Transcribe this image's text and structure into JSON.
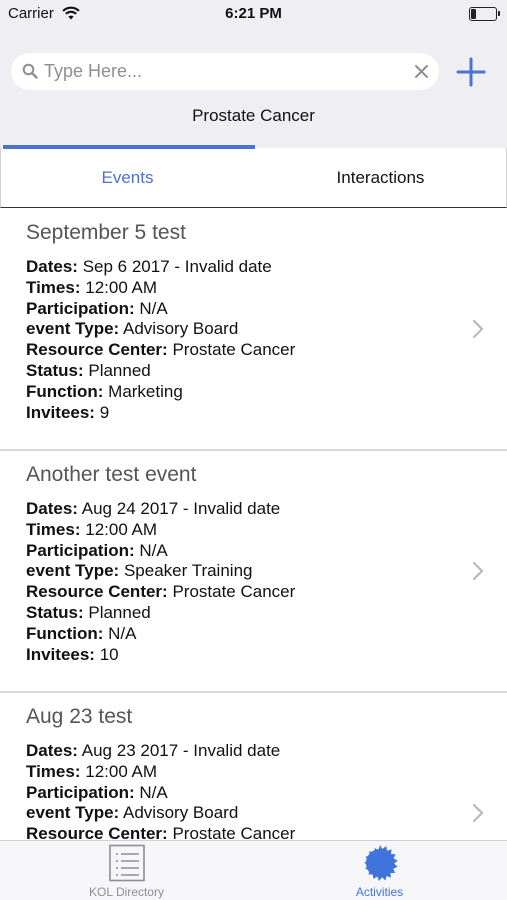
{
  "status_bar": {
    "carrier": "Carrier",
    "time": "6:21 PM"
  },
  "search": {
    "placeholder": "Type Here...",
    "value": ""
  },
  "resource_center": "Prostate Cancer",
  "tabs": [
    {
      "label": "Events",
      "active": true
    },
    {
      "label": "Interactions",
      "active": false
    }
  ],
  "field_labels": {
    "dates": "Dates:",
    "times": "Times:",
    "participation": "Participation:",
    "event_type": "event Type:",
    "resource_center": "Resource Center:",
    "status": "Status:",
    "function": "Function:",
    "invitees": "Invitees:"
  },
  "events": [
    {
      "title": "September 5 test",
      "dates": "Sep 6 2017 - Invalid date",
      "times": "12:00 AM",
      "participation": "N/A",
      "event_type": "Advisory Board",
      "resource_center": "Prostate Cancer",
      "status": "Planned",
      "function": "Marketing",
      "invitees": "9"
    },
    {
      "title": "Another test event",
      "dates": "Aug 24 2017 - Invalid date",
      "times": "12:00 AM",
      "participation": "N/A",
      "event_type": "Speaker Training",
      "resource_center": "Prostate Cancer",
      "status": "Planned",
      "function": "N/A",
      "invitees": "10"
    },
    {
      "title": "Aug 23 test",
      "dates": "Aug 23 2017 - Invalid date",
      "times": "12:00 AM",
      "participation": "N/A",
      "event_type": "Advisory Board",
      "resource_center": "Prostate Cancer",
      "status": "",
      "function": "",
      "invitees": ""
    }
  ],
  "tab_bar": [
    {
      "label": "KOL Directory",
      "icon": "list-icon",
      "active": false
    },
    {
      "label": "Activities",
      "icon": "gear-badge-icon",
      "active": true
    }
  ],
  "colors": {
    "accent": "#4a72d0",
    "background_top": "#eeeef3",
    "inactive": "#8e8e93"
  }
}
